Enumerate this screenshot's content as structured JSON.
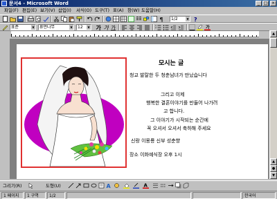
{
  "window": {
    "title": "문서4 - Microsoft Word",
    "minimize": "_",
    "maximize": "□",
    "close": "×"
  },
  "menu": [
    "파일(F)",
    "편집(E)",
    "보기(V)",
    "삽입(I)",
    "서식(O)",
    "도구(T)",
    "표(A)",
    "창(W)",
    "도움말(H)"
  ],
  "toolbar": {
    "zoom": "1/2",
    "style": "표준",
    "font": "휴먼나무",
    "size": "12"
  },
  "document": {
    "heading": "모시는 글",
    "lines": [
      "청교 발랄한 두 청춘남녀가 만났습니다",
      "",
      "그리고 이제",
      "행복한 결혼이야기를 만들어 나가려",
      "고 합니다.",
      "그 이야기가 시작되는 순간에",
      "꼭 오셔서 오셔서 축하해 주세요",
      "",
      "신랑 이몽룡 신부 성춘향",
      "",
      "장소 이화예식장 오후 1시"
    ]
  },
  "drawbar": {
    "draw": "그리기(R)",
    "autoshape": "도형(U)"
  },
  "status": {
    "page": "1 페이지",
    "section": "1 구역",
    "pages": "1/2",
    "lang": "한국어"
  },
  "colors": {
    "accent_red": "#e03030",
    "title_blue": "#0a246a",
    "dress_purple": "#c000c0"
  }
}
